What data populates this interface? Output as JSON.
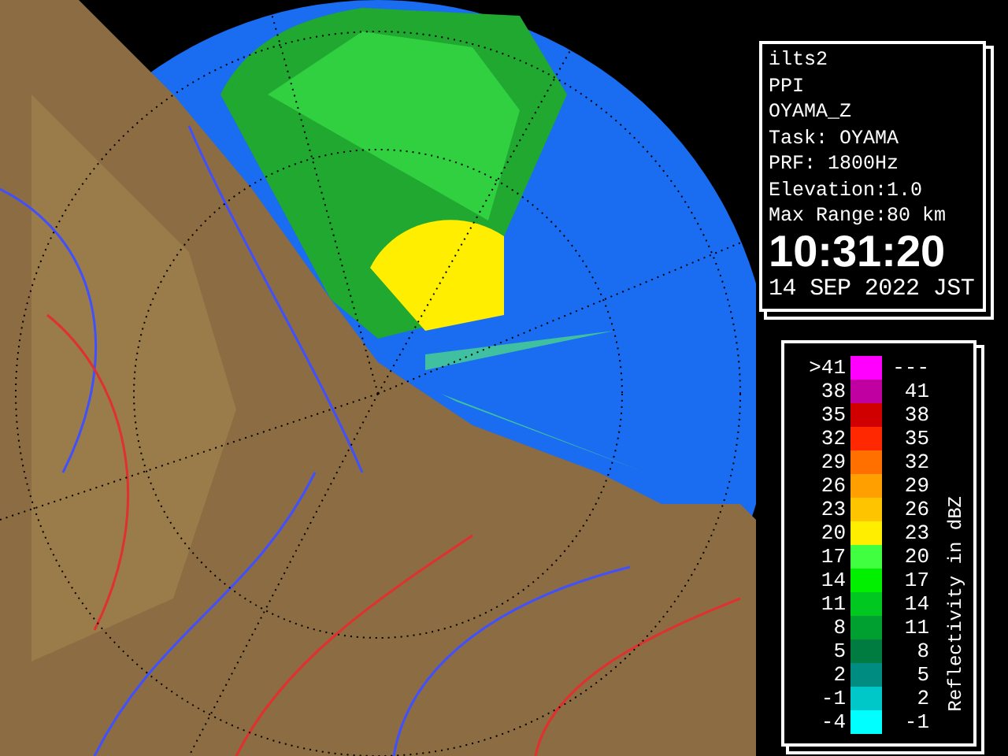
{
  "info": {
    "lines": [
      "ilts2",
      "PPI",
      "OYAMA_Z",
      "Task: OYAMA",
      "PRF: 1800Hz",
      "Elevation:1.0",
      "Max Range:80 km"
    ],
    "time": "10:31:20",
    "date": "14 SEP 2022 JST"
  },
  "legend": {
    "title": "Reflectivity in dBZ",
    "rows": [
      {
        "low": ">41",
        "high": "---",
        "color": "#ff00ff"
      },
      {
        "low": "38",
        "high": "41",
        "color": "#c000a0"
      },
      {
        "low": "35",
        "high": "38",
        "color": "#d00000"
      },
      {
        "low": "32",
        "high": "35",
        "color": "#ff2800"
      },
      {
        "low": "29",
        "high": "32",
        "color": "#ff7000"
      },
      {
        "low": "26",
        "high": "29",
        "color": "#ffa000"
      },
      {
        "low": "23",
        "high": "26",
        "color": "#ffc400"
      },
      {
        "low": "20",
        "high": "23",
        "color": "#ffee00"
      },
      {
        "low": "17",
        "high": "20",
        "color": "#40ff40"
      },
      {
        "low": "14",
        "high": "17",
        "color": "#00f000"
      },
      {
        "low": "11",
        "high": "14",
        "color": "#00c820"
      },
      {
        "low": "8",
        "high": "11",
        "color": "#00a030"
      },
      {
        "low": "5",
        "high": "8",
        "color": "#007c40"
      },
      {
        "low": "2",
        "high": "5",
        "color": "#008c80"
      },
      {
        "low": "-1",
        "high": "2",
        "color": "#00c8c8"
      },
      {
        "low": "-4",
        "high": "-1",
        "color": "#00ffff"
      }
    ]
  }
}
